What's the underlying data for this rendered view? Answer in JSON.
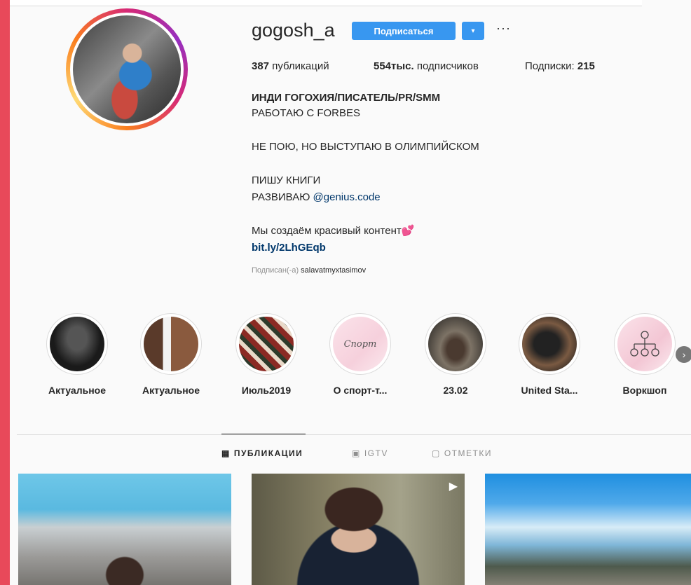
{
  "profile": {
    "username": "gogosh_a",
    "follow_label": "Подписаться",
    "dropdown_glyph": "▾",
    "more_glyph": "···"
  },
  "stats": {
    "posts_count": "387",
    "posts_label": "публикаций",
    "followers_count": "554тыс.",
    "followers_label": "подписчиков",
    "following_label": "Подписки:",
    "following_count": "215"
  },
  "bio": {
    "name": "ИНДИ ГОГОХИЯ/ПИСАТЕЛЬ/PR/SMM",
    "line1": "РАБОТАЮ С FORBES",
    "line2": "НЕ ПОЮ, НО ВЫСТУПАЮ В ОЛИМПИЙСКОМ",
    "line3": "ПИШУ КНИГИ",
    "line4_prefix": "РАЗВИВАЮ ",
    "line4_mention": "@genius.code",
    "line5": "Мы создаём красивый контент💕",
    "link": "bit.ly/2LhGEqb",
    "followed_prefix": "Подписан(-а)",
    "followed_user": "salavatmyxtasimov"
  },
  "highlights": [
    {
      "label": "Актуальное"
    },
    {
      "label": "Актуальное"
    },
    {
      "label": "Июль2019"
    },
    {
      "label": "О спорт-т...",
      "inner_text": "Спорт"
    },
    {
      "label": "23.02"
    },
    {
      "label": "United Sta..."
    },
    {
      "label": "Воркшоп"
    }
  ],
  "tabs": [
    {
      "label": "ПУБЛИКАЦИИ",
      "icon": "grid-icon",
      "glyph": "▦"
    },
    {
      "label": "IGTV",
      "icon": "igtv-icon",
      "glyph": "▣"
    },
    {
      "label": "ОТМЕТКИ",
      "icon": "tagged-icon",
      "glyph": "▢"
    }
  ],
  "colors": {
    "accent": "#3897f0",
    "frame": "#e8495a",
    "text": "#262626",
    "muted": "#8e8e8e"
  }
}
